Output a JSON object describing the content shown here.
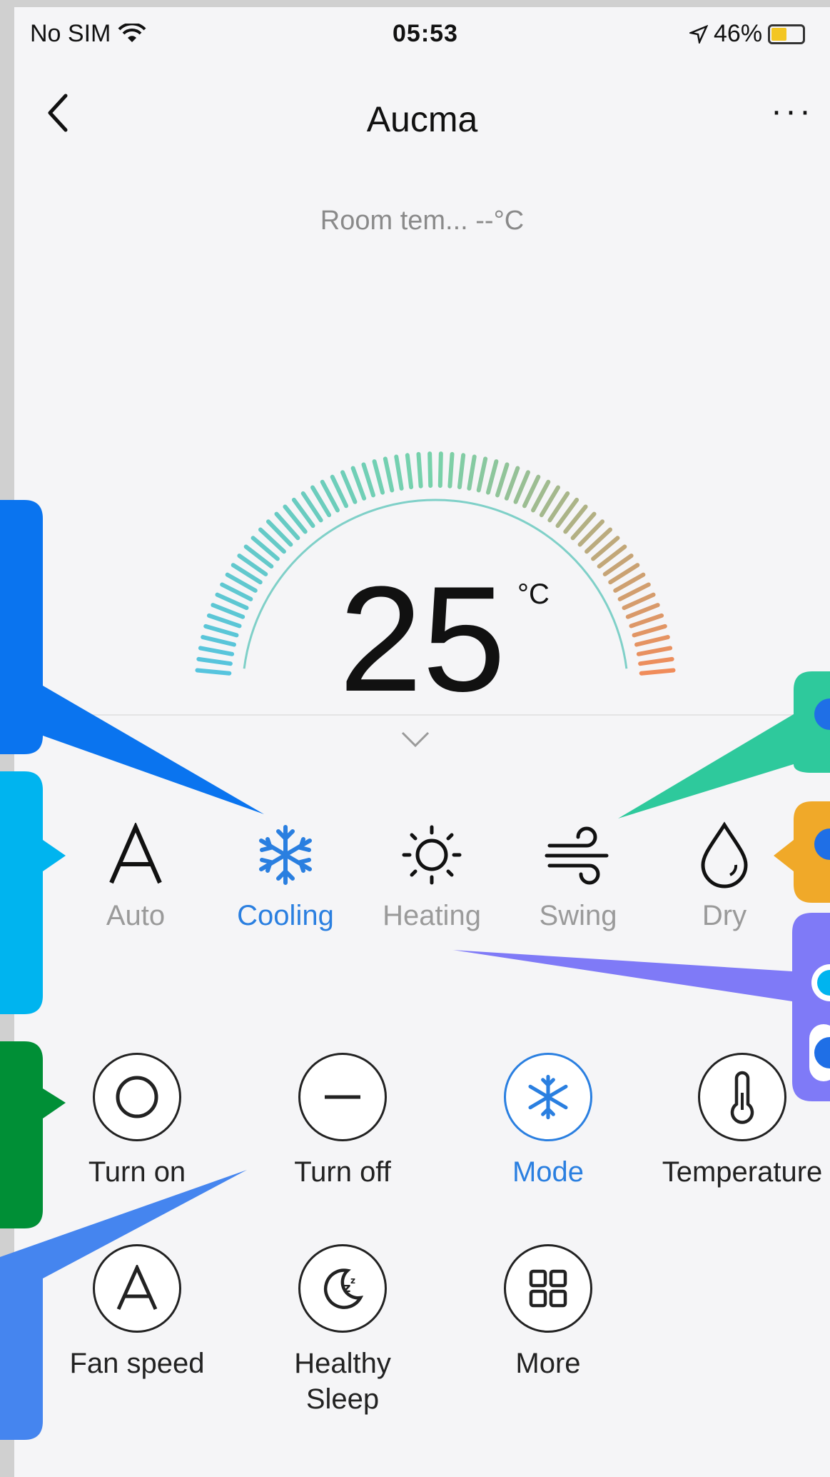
{
  "status_bar": {
    "carrier": "No SIM",
    "time": "05:53",
    "battery": "46%",
    "battery_level": 0.46
  },
  "nav": {
    "title": "Aucma",
    "more": "···"
  },
  "room_temperature": {
    "label": "Room tem...",
    "value": "--°C"
  },
  "setpoint": {
    "value": "25",
    "unit": "°C"
  },
  "modes": [
    {
      "label": "Auto",
      "icon": "auto-letter-icon",
      "active": false
    },
    {
      "label": "Cooling",
      "icon": "snowflake-icon",
      "active": true
    },
    {
      "label": "Heating",
      "icon": "sun-icon",
      "active": false
    },
    {
      "label": "Swing",
      "icon": "wind-icon",
      "active": false
    },
    {
      "label": "Dry",
      "icon": "water-drop-icon",
      "active": false
    }
  ],
  "functions": [
    {
      "label": "Turn on",
      "icon": "power-on-icon",
      "active": false
    },
    {
      "label": "Turn off",
      "icon": "power-off-icon",
      "active": false
    },
    {
      "label": "Mode",
      "icon": "snowflake-icon",
      "active": true
    },
    {
      "label": "Temperature",
      "icon": "thermometer-icon",
      "active": false
    },
    {
      "label": "Fan speed",
      "icon": "fan-auto-icon",
      "active": false
    },
    {
      "label": "Healthy\nSleep",
      "icon": "sleep-moon-icon",
      "active": false
    },
    {
      "label": "More",
      "icon": "grid-icon",
      "active": false
    }
  ],
  "colors": {
    "accent": "#2a7fe0",
    "callout_blue": "#0a74ef",
    "callout_cyan": "#00b4ef",
    "callout_green": "#008f36",
    "callout_teal": "#2ec99c",
    "callout_orange": "#f0a929",
    "callout_purple": "#7f7af7",
    "callout_blue2": "#4585ef"
  }
}
